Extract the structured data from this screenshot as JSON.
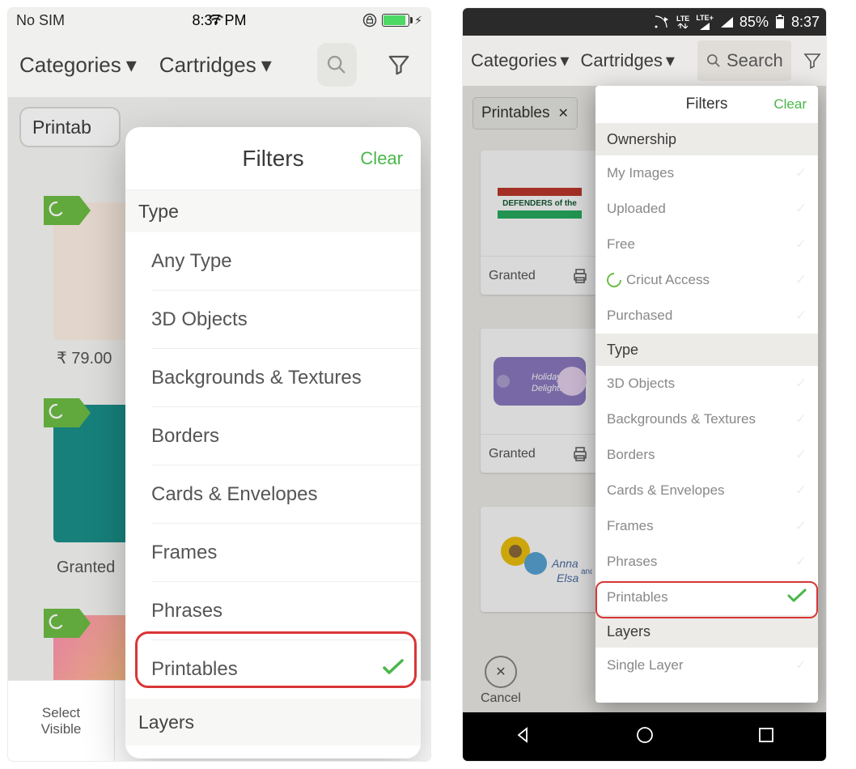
{
  "ios": {
    "status": {
      "carrier": "No SIM",
      "time": "8:37 PM"
    },
    "toolbar": {
      "categories": "Categories",
      "cartridges": "Cartridges"
    },
    "chip": "Printab",
    "price": "₹ 79.00",
    "granted": "Granted",
    "bottombar": {
      "select_visible_1": "Select",
      "select_visible_2": "Visible"
    },
    "popover": {
      "title": "Filters",
      "clear": "Clear",
      "section_type": "Type",
      "section_layers": "Layers",
      "items": {
        "any_type": "Any Type",
        "3d_objects": "3D Objects",
        "backgrounds": "Backgrounds & Textures",
        "borders": "Borders",
        "cards": "Cards & Envelopes",
        "frames": "Frames",
        "phrases": "Phrases",
        "printables": "Printables"
      }
    }
  },
  "android": {
    "status": {
      "battery_pct": "85%",
      "time": "8:37"
    },
    "toolbar": {
      "categories": "Categories",
      "cartridges": "Cartridges",
      "search": "Search"
    },
    "chip": "Printables",
    "cards": {
      "granted": "Granted"
    },
    "cancel": "Cancel",
    "popover": {
      "title": "Filters",
      "clear": "Clear",
      "section_ownership": "Ownership",
      "section_type": "Type",
      "section_layers": "Layers",
      "ownership_items": {
        "my_images": "My Images",
        "uploaded": "Uploaded",
        "free": "Free",
        "cricut_access": "Cricut Access",
        "purchased": "Purchased"
      },
      "type_items": {
        "3d_objects": "3D Objects",
        "backgrounds": "Backgrounds & Textures",
        "borders": "Borders",
        "cards": "Cards & Envelopes",
        "frames": "Frames",
        "phrases": "Phrases",
        "printables": "Printables"
      },
      "layers_items": {
        "single": "Single Layer"
      }
    }
  }
}
